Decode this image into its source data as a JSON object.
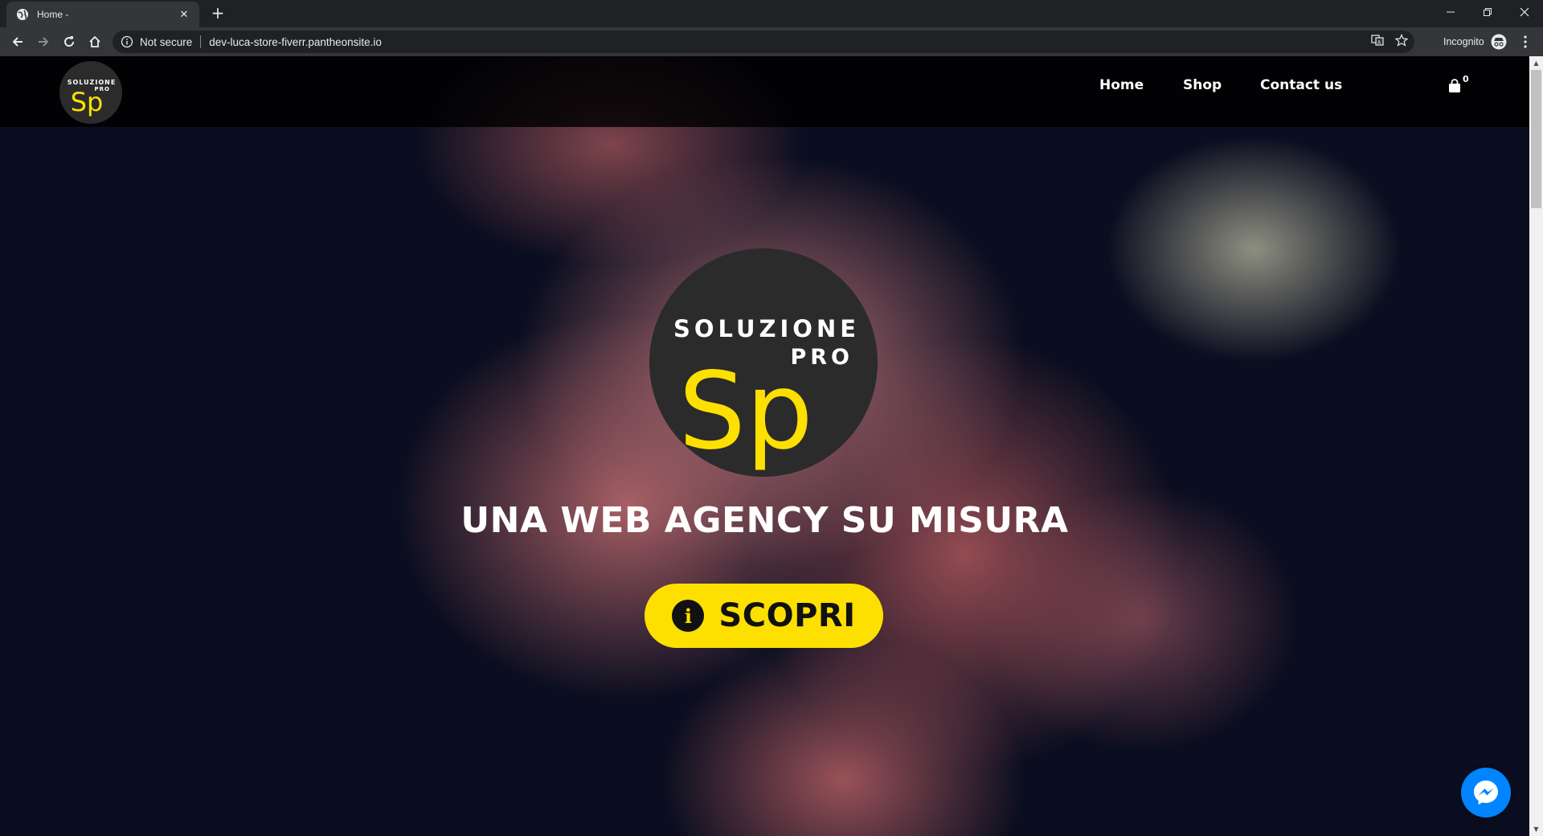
{
  "browser": {
    "tab_title": "Home -",
    "tab_close": "✕",
    "new_tab": "+",
    "not_secure": "Not secure",
    "url": "dev-luca-store-fiverr.pantheonsite.io",
    "incognito_label": "Incognito"
  },
  "site": {
    "logo_text_top": "SOLUZIONE",
    "logo_text_pro": "PRO",
    "logo_monogram": "Sp",
    "nav": [
      {
        "label": "Home"
      },
      {
        "label": "Shop"
      },
      {
        "label": "Contact us"
      }
    ],
    "cart_count": "0",
    "hero_title": "UNA WEB AGENCY SU MISURA",
    "cta_label": "SCOPRI",
    "cta_icon": "i"
  },
  "colors": {
    "accent_yellow": "#fde000",
    "logo_dark": "#2b2b2b",
    "messenger_blue": "#0084ff",
    "header_bg": "#000000"
  }
}
